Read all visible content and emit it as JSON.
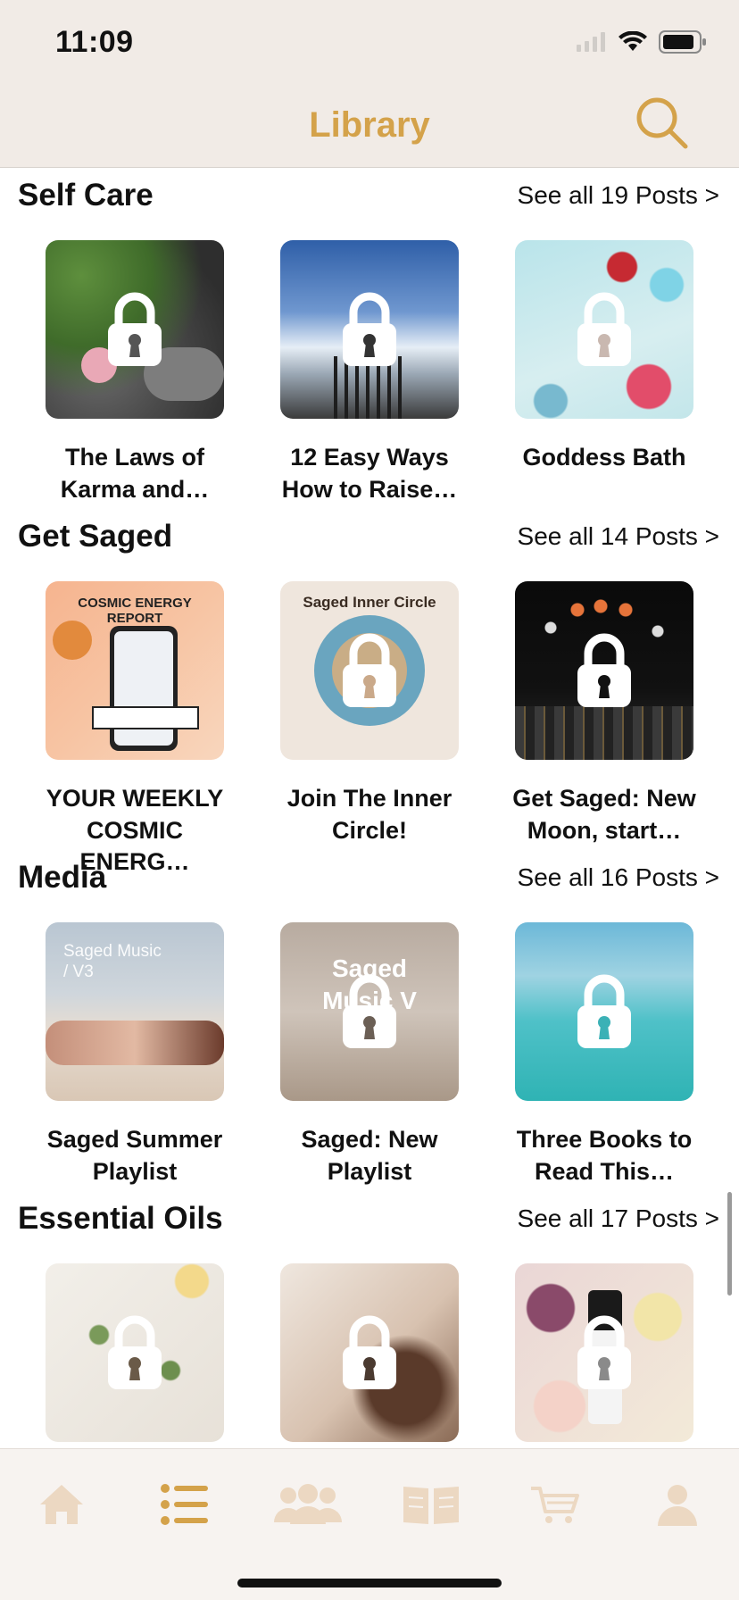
{
  "status_bar": {
    "time": "11:09"
  },
  "nav": {
    "title": "Library",
    "search_icon": "search-icon"
  },
  "colors": {
    "accent": "#d4a24a",
    "tab_inactive": "#ecd8c2",
    "header_bg": "#f1ebe6"
  },
  "sections": [
    {
      "title": "Self Care",
      "see_all": "See all 19 Posts >",
      "posts": [
        {
          "title": "The Laws of Karma and…",
          "locked": true
        },
        {
          "title": "12 Easy Ways How to Raise…",
          "locked": true
        },
        {
          "title": "Goddess Bath",
          "locked": true
        }
      ]
    },
    {
      "title": "Get Saged",
      "see_all": "See all 14 Posts >",
      "posts": [
        {
          "title": "YOUR WEEKLY COSMIC ENERG…",
          "locked": false,
          "thumb_text": "COSMIC ENERGY REPORT"
        },
        {
          "title": "Join The Inner Circle!",
          "locked": true,
          "thumb_text": "Saged Inner Circle"
        },
        {
          "title": "Get Saged: New Moon, start…",
          "locked": true
        }
      ]
    },
    {
      "title": "Media",
      "see_all": "See all 16 Posts >",
      "posts": [
        {
          "title": "Saged Summer Playlist",
          "locked": false,
          "thumb_text": "Saged Music / V3"
        },
        {
          "title": "Saged: New Playlist",
          "locked": true,
          "thumb_text": "Saged Music V"
        },
        {
          "title": "Three Books to Read This…",
          "locked": true
        }
      ]
    },
    {
      "title": "Essential Oils",
      "see_all": "See all 17 Posts >",
      "posts": [
        {
          "title": "",
          "locked": true
        },
        {
          "title": "",
          "locked": true
        },
        {
          "title": "",
          "locked": true
        }
      ]
    }
  ],
  "tabs": [
    {
      "name": "home",
      "icon": "home-icon",
      "active": false
    },
    {
      "name": "library",
      "icon": "list-icon",
      "active": true
    },
    {
      "name": "community",
      "icon": "people-icon",
      "active": false
    },
    {
      "name": "courses",
      "icon": "book-icon",
      "active": false
    },
    {
      "name": "shop",
      "icon": "cart-icon",
      "active": false
    },
    {
      "name": "profile",
      "icon": "person-icon",
      "active": false
    }
  ]
}
